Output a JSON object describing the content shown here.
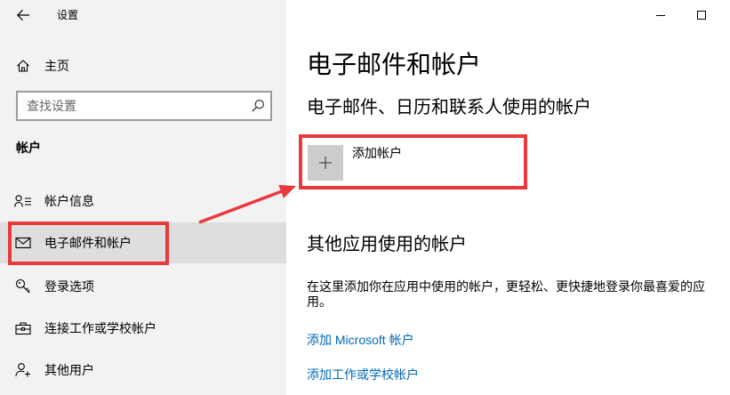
{
  "colors": {
    "sidebar_bg": "#f2f2f2",
    "selected_bg": "#dedede",
    "link": "#0067b8",
    "annotation": "#e8393d",
    "add_tile_bg": "#cccccc"
  },
  "window_controls": {
    "minimize": "minimize-icon",
    "maximize": "maximize-icon"
  },
  "sidebar": {
    "back_icon": "back-arrow-icon",
    "title": "设置",
    "home": {
      "label": "主页",
      "icon": "home-icon"
    },
    "search": {
      "placeholder": "查找设置",
      "icon": "search-icon"
    },
    "section_heading": "帐户",
    "items": [
      {
        "label": "帐户信息",
        "icon": "account-info-icon",
        "selected": false
      },
      {
        "label": "电子邮件和帐户",
        "icon": "mail-icon",
        "selected": true
      },
      {
        "label": "登录选项",
        "icon": "key-icon",
        "selected": false
      },
      {
        "label": "连接工作或学校帐户",
        "icon": "briefcase-icon",
        "selected": false
      },
      {
        "label": "其他用户",
        "icon": "add-user-icon",
        "selected": false
      }
    ]
  },
  "main": {
    "title": "电子邮件和帐户",
    "email_accounts": {
      "heading": "电子邮件、日历和联系人使用的帐户",
      "add_account": {
        "label": "添加帐户",
        "icon": "plus-icon"
      }
    },
    "app_accounts": {
      "heading": "其他应用使用的帐户",
      "description": "在这里添加你在应用中使用的帐户，更轻松、更快捷地登录你最喜爱的应用。",
      "links": [
        {
          "label": "添加 Microsoft 帐户"
        },
        {
          "label": "添加工作或学校帐户"
        }
      ]
    }
  }
}
